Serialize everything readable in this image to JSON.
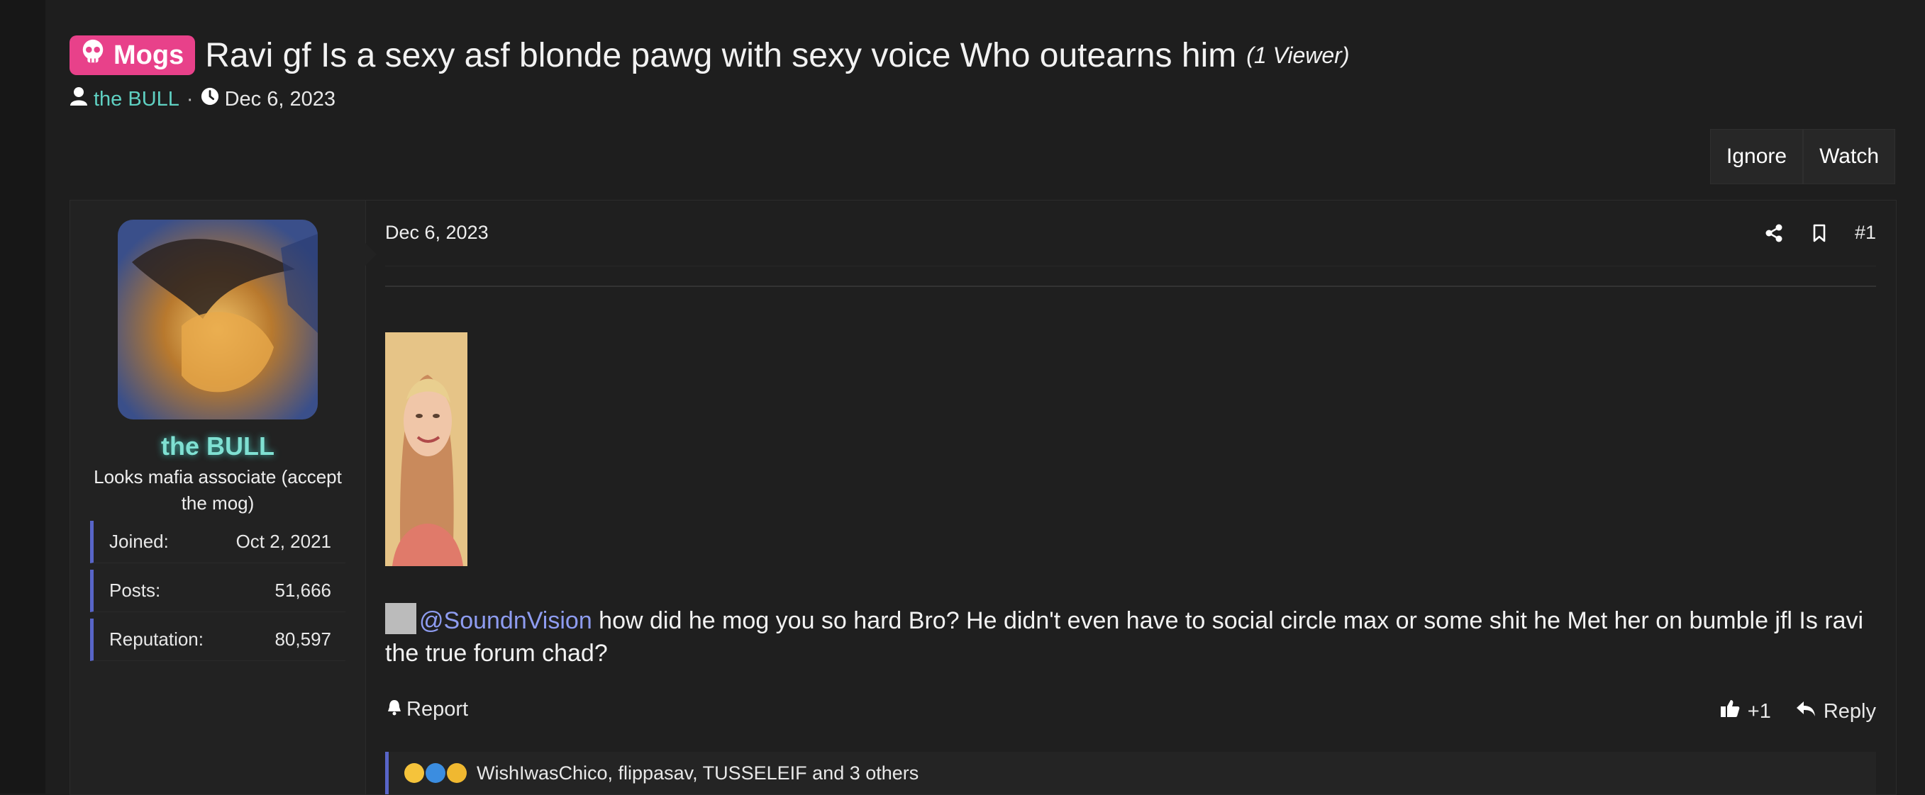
{
  "thread": {
    "prefix": "Mogs",
    "title": "Ravi gf Is a sexy asf blonde pawg with sexy voice Who outearns him",
    "viewers": "(1 Viewer)",
    "author": "the BULL",
    "date": "Dec 6, 2023"
  },
  "toolbar": {
    "ignore_label": "Ignore",
    "watch_label": "Watch"
  },
  "post": {
    "date": "Dec 6, 2023",
    "number": "#1",
    "user": {
      "name": "the BULL",
      "title": "Looks mafia associate (accept the mog)",
      "stats": [
        {
          "label": "Joined:",
          "value": "Oct 2, 2021"
        },
        {
          "label": "Posts:",
          "value": "51,666"
        },
        {
          "label": "Reputation:",
          "value": "80,597"
        }
      ]
    },
    "mention": "@SoundnVision",
    "body": " how did he mog you so hard Bro? He didn't even have to social circle max or some shit he Met her on bumble jfl Is ravi the true forum chad?",
    "report_label": "Report",
    "plus_label": "+1",
    "reply_label": "Reply",
    "reactions_text": "WishIwasChico, flippasav, TUSSELEIF and 3 others"
  },
  "icons": [
    "skull-icon",
    "user-icon",
    "clock-icon",
    "share-icon",
    "bookmark-icon",
    "bell-icon",
    "thumbs-up-icon",
    "reply-icon"
  ],
  "colors": {
    "prefix_bg": "#e8418a",
    "username": "#7fe0d2",
    "mention": "#8e9cf0",
    "accent_bar": "#5865c8"
  }
}
